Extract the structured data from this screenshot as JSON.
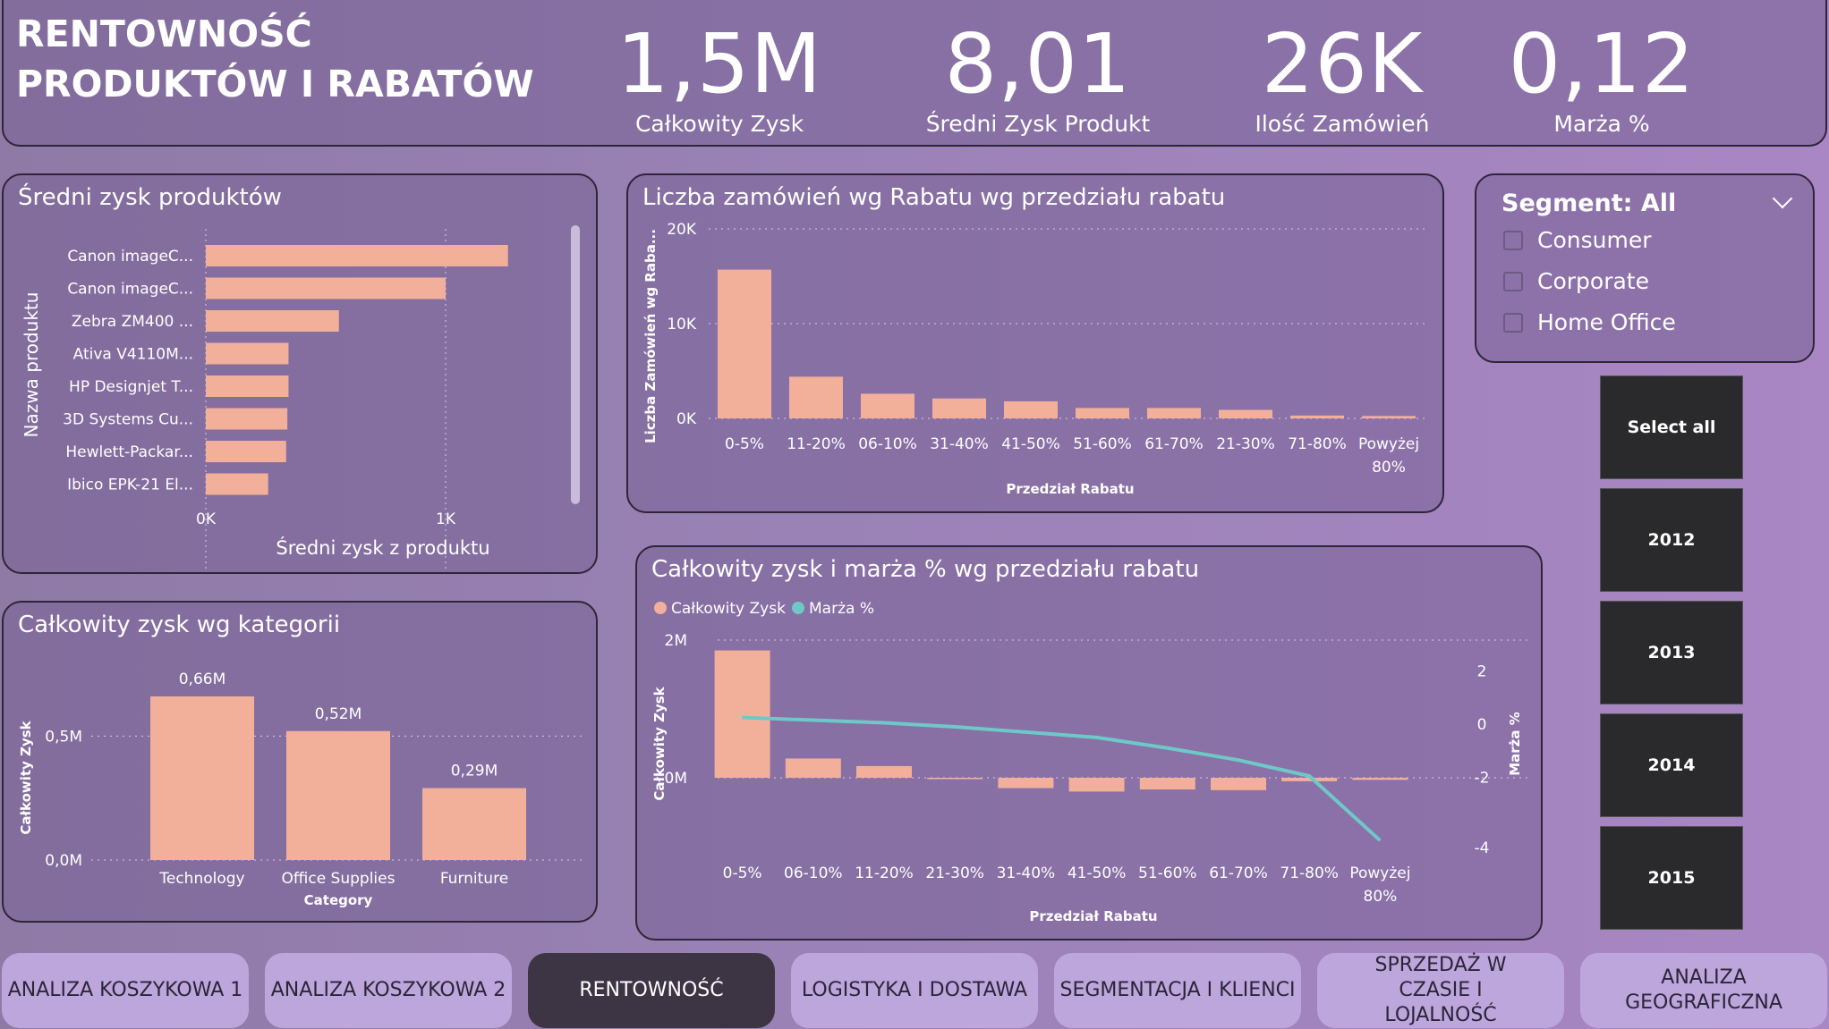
{
  "header": {
    "title_line1": "RENTOWNOŚĆ",
    "title_line2": "PRODUKTÓW I RABATÓW",
    "kpis": [
      {
        "value": "1,5M",
        "label": "Całkowity Zysk"
      },
      {
        "value": "8,01",
        "label": "Średni Zysk Produkt"
      },
      {
        "value": "26K",
        "label": "Ilość Zamówień"
      },
      {
        "value": "0,12",
        "label": "Marża %"
      }
    ]
  },
  "slicer": {
    "title": "Segment: All",
    "options": [
      "Consumer",
      "Corporate",
      "Home Office"
    ]
  },
  "years": [
    "Select all",
    "2012",
    "2013",
    "2014",
    "2015"
  ],
  "tabs": [
    {
      "label": "ANALIZA KOSZYKOWA 1",
      "active": false
    },
    {
      "label": "ANALIZA KOSZYKOWA 2",
      "active": false
    },
    {
      "label": "RENTOWNOŚĆ",
      "active": true
    },
    {
      "label": "LOGISTYKA I DOSTAWA",
      "active": false
    },
    {
      "label": "SEGMENTACJA I KLIENCI",
      "active": false
    },
    {
      "label": "SPRZEDAŻ W CZASIE I LOJALNOŚĆ",
      "active": false
    },
    {
      "label": "ANALIZA GEOGRAFICZNA",
      "active": false
    }
  ],
  "colors": {
    "bar": "#f2b09a",
    "line": "#6ec8c8",
    "gridline": "#d8cce6"
  },
  "chart_data": [
    {
      "id": "avg_profit",
      "type": "bar",
      "orientation": "horizontal",
      "title": "Średni zysk produktów",
      "xlabel": "Średni zysk z produktu",
      "ylabel": "Nazwa produktu",
      "categories": [
        "Canon imageC...",
        "Canon imageC...",
        "Zebra ZM400 ...",
        "Ativa V4110M...",
        "HP Designjet T...",
        "3D Systems Cu...",
        "Hewlett-Packar...",
        "Ibico EPK-21 El..."
      ],
      "values": [
        1260,
        1000,
        555,
        345,
        345,
        340,
        335,
        260
      ],
      "xlim": [
        0,
        1500
      ],
      "xticks": [
        "0K",
        "1K"
      ]
    },
    {
      "id": "orders_by_discount",
      "type": "bar",
      "title": "Liczba zamówień wg Rabatu wg przedziału rabatu",
      "xlabel": "Przedział Rabatu",
      "ylabel": "Liczba Zamówień wg Raba...",
      "categories": [
        "0-5%",
        "11-20%",
        "06-10%",
        "31-40%",
        "41-50%",
        "51-60%",
        "61-70%",
        "21-30%",
        "71-80%",
        "Powyżej 80%"
      ],
      "values": [
        15700,
        4400,
        2600,
        2100,
        1800,
        1100,
        1100,
        900,
        300,
        250
      ],
      "ylim": [
        0,
        20000
      ],
      "yticks": [
        "0K",
        "10K",
        "20K"
      ]
    },
    {
      "id": "profit_by_category",
      "type": "bar",
      "title": "Całkowity zysk wg kategorii",
      "xlabel": "Category",
      "ylabel": "Całkowity Zysk",
      "categories": [
        "Technology",
        "Office Supplies",
        "Furniture"
      ],
      "values": [
        0.66,
        0.52,
        0.29
      ],
      "data_labels": [
        "0,66M",
        "0,52M",
        "0,29M"
      ],
      "ylim": [
        0,
        0.75
      ],
      "yticks": [
        "0,0M",
        "0,5M"
      ]
    },
    {
      "id": "profit_margin_by_discount",
      "type": "bar",
      "title": "Całkowity zysk i marża % wg przedziału rabatu",
      "xlabel": "Przedział Rabatu",
      "ylabel": "Całkowity Zysk",
      "y2label": "Marża %",
      "categories": [
        "0-5%",
        "06-10%",
        "11-20%",
        "21-30%",
        "31-40%",
        "41-50%",
        "51-60%",
        "61-70%",
        "71-80%",
        "Powyżej 80%"
      ],
      "series": [
        {
          "name": "Całkowity Zysk",
          "values": [
            1.85,
            0.28,
            0.17,
            -0.01,
            -0.15,
            -0.2,
            -0.17,
            -0.18,
            -0.05,
            -0.03
          ]
        },
        {
          "name": "Marża %",
          "values": [
            0.25,
            0.15,
            0.05,
            -0.1,
            -0.3,
            -0.5,
            -0.9,
            -1.35,
            -1.95,
            -3.8
          ]
        }
      ],
      "ylim": [
        -1.5,
        2.1
      ],
      "y2lim": [
        -4.3,
        2.3
      ],
      "yticks": [
        "0M",
        "2M"
      ],
      "y2ticks": [
        "2",
        "0",
        "-2",
        "-4"
      ]
    }
  ]
}
